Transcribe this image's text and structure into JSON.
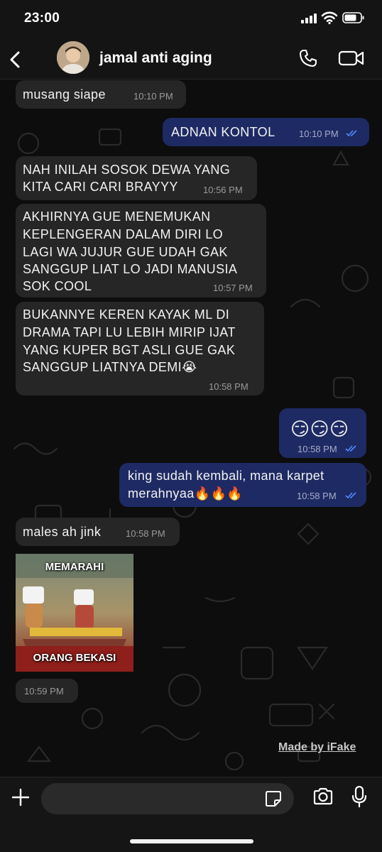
{
  "status_bar": {
    "time": "23:00"
  },
  "header": {
    "contact_name": "jamal anti aging"
  },
  "messages": [
    {
      "direction": "in",
      "text": "musang siape",
      "time": "10:10 PM"
    },
    {
      "direction": "out",
      "text": "ADNAN KONTOL",
      "time": "10:10 PM",
      "read": true
    },
    {
      "direction": "in",
      "lines": [
        "NAH INILAH SOSOK DEWA YANG",
        "KITA CARI CARI BRAYYY"
      ],
      "time": "10:56 PM"
    },
    {
      "direction": "in",
      "lines": [
        "AKHIRNYA GUE MENEMUKAN",
        "KEPLENGERAN DALAM DIRI LO",
        "LAGI WA JUJUR GUE UDAH GAK",
        "SANGGUP LIAT LO JADI MANUSIA",
        "SOK COOL"
      ],
      "time": "10:57 PM"
    },
    {
      "direction": "in",
      "lines": [
        "BUKANNYE KEREN KAYAK ML DI",
        "DRAMA TAPI LU LEBIH MIRIP IJAT",
        "YANG KUPER BGT ASLI GUE GAK",
        "SANGGUP LIATNYA DEMI😭"
      ],
      "time": "10:58 PM"
    },
    {
      "direction": "out",
      "text": "😏😏😏",
      "time": "10:58 PM",
      "read": true
    },
    {
      "direction": "out",
      "lines": [
        "king sudah kembali, mana karpet",
        "merahnyaa🔥🔥🔥"
      ],
      "time": "10:58 PM",
      "read": true
    },
    {
      "direction": "in",
      "text": "males ah jink",
      "time": "10:58 PM"
    },
    {
      "direction": "in",
      "type": "image",
      "caption_top": "MEMARAHI",
      "caption_bottom": "ORANG BEKASI",
      "time": "10:59 PM"
    }
  ],
  "watermark": "Made by iFake",
  "colors": {
    "incoming": "#262626",
    "outgoing": "#1e2a63",
    "read_ticks": "#4f8cff"
  },
  "icons": [
    "back-chevron-icon",
    "phone-icon",
    "video-camera-icon",
    "plus-icon",
    "sticker-icon",
    "camera-icon",
    "microphone-icon"
  ]
}
